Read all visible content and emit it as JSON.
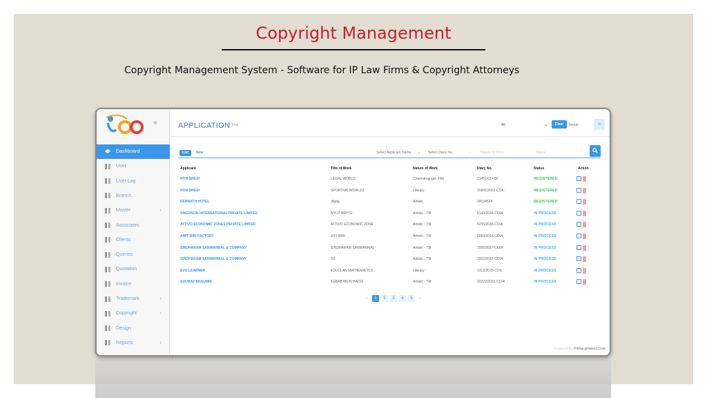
{
  "slide": {
    "title": "Copyright Management",
    "subtitle": "Copyright Management System - Software for IP Law Firms & Copyright Attorneys"
  },
  "sidebar": {
    "collapse": "«",
    "items": [
      {
        "label": "Dashboard",
        "active": true,
        "chevron": ""
      },
      {
        "label": "User",
        "chevron": ""
      },
      {
        "label": "User Log",
        "chevron": ""
      },
      {
        "label": "Branch",
        "chevron": ""
      },
      {
        "label": "Master",
        "chevron": "›"
      },
      {
        "label": "Associates",
        "chevron": ""
      },
      {
        "label": "Clients",
        "chevron": ""
      },
      {
        "label": "Queries",
        "chevron": ""
      },
      {
        "label": "Quotation",
        "chevron": ""
      },
      {
        "label": "Invoice",
        "chevron": ""
      },
      {
        "label": "Trademark",
        "chevron": "›"
      },
      {
        "label": "Copyright",
        "chevron": "›"
      },
      {
        "label": "Design",
        "chevron": ""
      },
      {
        "label": "Reports",
        "chevron": "›"
      }
    ]
  },
  "header": {
    "title": "APPLICATION",
    "total": "45 Total",
    "filter_all": "All",
    "chevron": "⌄",
    "clear": "Clear",
    "inexpt": "Inexpt",
    "o_button": "o"
  },
  "tabs": {
    "list": "List",
    "new": "New"
  },
  "filters": {
    "applicant": "Select Applicant Name",
    "diary": "Select Diary No.",
    "nature": "Nature of Work",
    "status": "Status"
  },
  "table": {
    "headers": [
      "Applicant",
      "Title of Work",
      "Nature of Work",
      "Diary No.",
      "Status",
      "Action"
    ],
    "rows": [
      {
        "applicant": "RIYA SINGH",
        "title": "LEGAL WORLD",
        "nature": "Cinematograph Film",
        "diary": "21451/CO-CF",
        "status": "REGISTERED",
        "kind": "reg"
      },
      {
        "applicant": "RIYA SINGH",
        "title": "SPORTNIK WORLDZ",
        "nature": "Literary",
        "diary": "15841/2022-CO/L",
        "status": "REGISTERED",
        "kind": "reg"
      },
      {
        "applicant": "DEBNATH HOTEL",
        "title": "dfgdg",
        "nature": "Artistic",
        "diary": "34534534",
        "status": "REGISTERED",
        "kind": "reg"
      },
      {
        "applicant": "SINGHSON INTERNATIONAL PRIVATE LIMITED",
        "title": "NYLO BRYTE",
        "nature": "Artistic - TM",
        "diary": "6143/2016-CO/A",
        "status": "IN PROCESS",
        "kind": "proc"
      },
      {
        "applicant": "ATTIVO ECONOMIC ZONES PRIVATE LIMITED",
        "title": "ATTIVO ECONOMIC ZONE",
        "nature": "Artistic - TM",
        "diary": "6235/2016-CO/A",
        "status": "IN PROCESS",
        "kind": "proc"
      },
      {
        "applicant": "AMIT BIRI FACTORY",
        "title": "JOY BIRI",
        "nature": "Artistic - TM",
        "diary": "5059/2016-CO/A",
        "status": "IN PROCESS",
        "kind": "proc"
      },
      {
        "applicant": "SINDHARAM SANWARMAL & COMPANY",
        "title": "SINDHARAM SANWARMAL",
        "nature": "Artistic - TM",
        "diary": "1595/2017-CO/A",
        "status": "IN PROCESS",
        "kind": "proc"
      },
      {
        "applicant": "SINDHARAM SANWARMAL & COMPANY",
        "title": "SS",
        "nature": "Artistic - TM",
        "diary": "1602/2017-CO/A",
        "status": "IN PROCESS",
        "kind": "proc"
      },
      {
        "applicant": "EVO LEARNER",
        "title": "EDUCLAN MATHEMATICS",
        "nature": "Literary",
        "diary": "1312/2020-CO/L",
        "status": "IN PROCESS",
        "kind": "proc"
      },
      {
        "applicant": "SOURAV BHAUMIK",
        "title": "KEBAB MEIN HADDI",
        "nature": "Artistic - TM",
        "diary": "20222/2021-CO/A",
        "status": "IN PROCESS",
        "kind": "proc"
      }
    ]
  },
  "pagination": {
    "prev": "‹",
    "pages": [
      "1",
      "2",
      "3",
      "4",
      "5"
    ],
    "next": "›",
    "current": "1"
  },
  "footer": {
    "prefix": "Powered By",
    "brand": "Primacyintelect.Com"
  }
}
